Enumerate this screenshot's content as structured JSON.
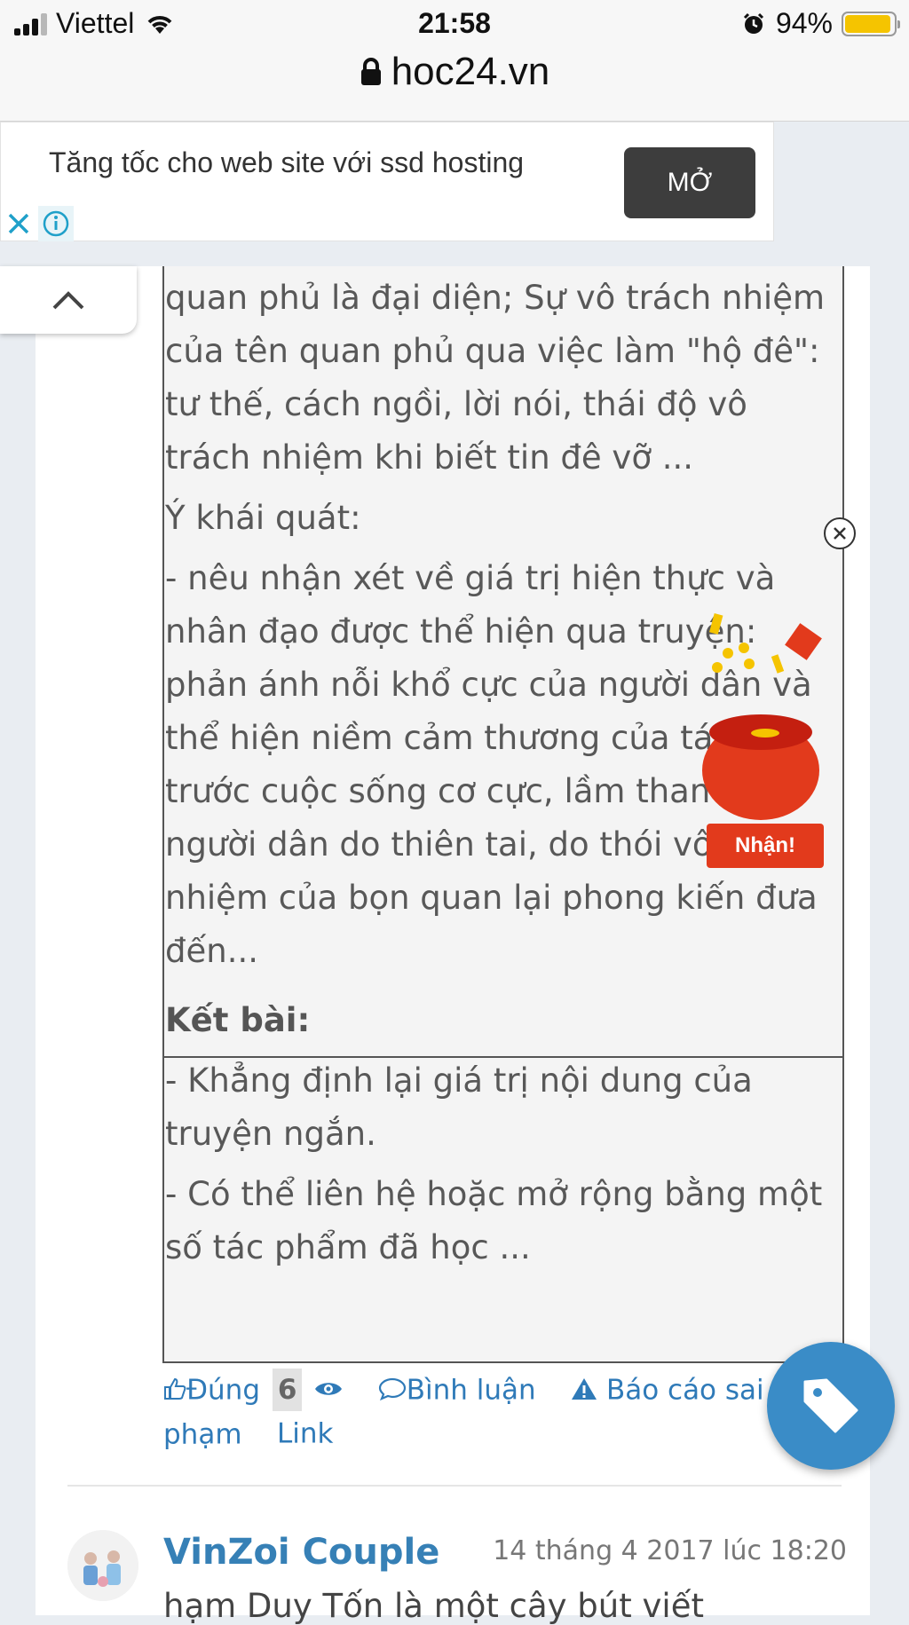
{
  "status_bar": {
    "carrier": "Viettel",
    "time": "21:58",
    "battery": "94%",
    "battery_level": 0.94
  },
  "address_bar": {
    "url": "hoc24.vn"
  },
  "ad": {
    "text": "Tăng tốc cho web site với ssd hosting",
    "open_label": "MỞ"
  },
  "answer": {
    "paragraphs": [
      "quan phủ là đại diện; Sự vô trách nhiệm của tên quan phủ qua việc làm \"hộ đê\": tư thế, cách ngồi, lời nói, thái độ vô trách nhiệm khi biết tin đê vỡ ...",
      "Ý khái quát:",
      "- nêu nhận xét về giá trị hiện thực và nhân đạo được thể hiện qua truyện: phản ánh nỗi khổ cực của người dân và thể hiện niềm cảm thương của tác giả trước cuộc sống cơ cực, lầm than của người dân do thiên tai, do thói vô trách nhiệm của bọn quan lại phong kiến đưa đến..."
    ],
    "conclusion_heading": "Kết bài:",
    "conclusion_paragraphs": [
      "- Khẳng định lại giá trị nội dung của truyện ngắn.",
      "- Có thể liên hệ hoặc mở rộng bằng một số tác phẩm đã học ..."
    ]
  },
  "promo": {
    "button_label": "Nhận!"
  },
  "actions": {
    "correct_label": "Đúng",
    "correct_count": "6",
    "comment_label": "Bình luận",
    "report_label": "Báo cáo sai phạm",
    "link_label": "Link"
  },
  "next_post": {
    "author": "VinZoi Couple",
    "timestamp": "14 tháng 4 2017 lúc 18:20",
    "preview": "hạm Duy Tốn là một cây bút viết"
  },
  "colors": {
    "link_blue": "#2f7ab8",
    "fab_blue": "#3a8cc7",
    "promo_red": "#e23a1c"
  }
}
